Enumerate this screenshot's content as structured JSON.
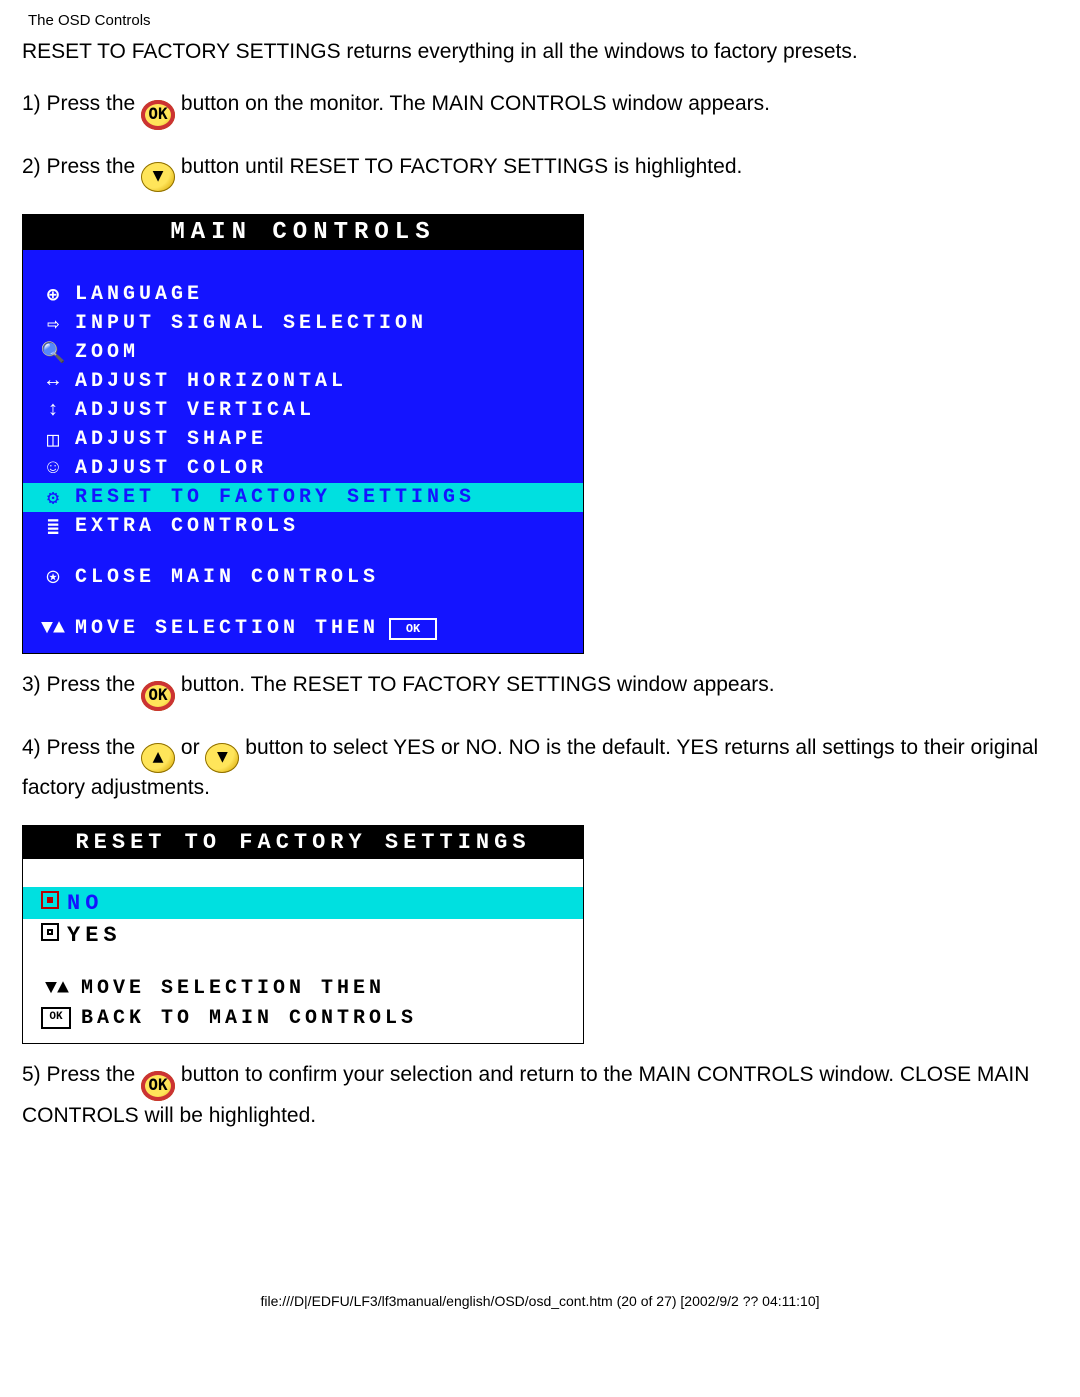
{
  "page_header": "The OSD Controls",
  "intro": "RESET TO FACTORY SETTINGS returns everything in all the windows to factory presets.",
  "steps": {
    "s1a": "1) Press the ",
    "s1b": " button on the monitor. The MAIN CONTROLS window appears.",
    "s2a": "2) Press the ",
    "s2b": " button until RESET TO FACTORY SETTINGS is highlighted.",
    "s3a": "3) Press the ",
    "s3b": " button. The RESET TO FACTORY SETTINGS window appears.",
    "s4a": "4) Press the ",
    "s4b": " or ",
    "s4c": " button to select YES or NO. NO is the default. YES returns all settings to their original factory adjustments.",
    "s5a": "5) Press the ",
    "s5b": " button to confirm your selection and return to the MAIN CONTROLS window. CLOSE MAIN CONTROLS will be highlighted."
  },
  "icon_glyphs": {
    "ok": "OK",
    "down": "▼",
    "up": "▲",
    "updown": "▼▲",
    "okbox": "OK"
  },
  "osd1": {
    "title": "MAIN CONTROLS",
    "items": [
      {
        "icon": "⊕",
        "label": "LANGUAGE"
      },
      {
        "icon": "⇨",
        "label": "INPUT SIGNAL SELECTION"
      },
      {
        "icon": "🔍",
        "label": "ZOOM"
      },
      {
        "icon": "↔",
        "label": "ADJUST HORIZONTAL"
      },
      {
        "icon": "↕",
        "label": "ADJUST VERTICAL"
      },
      {
        "icon": "◫",
        "label": "ADJUST SHAPE"
      },
      {
        "icon": "☺",
        "label": "ADJUST COLOR"
      },
      {
        "icon": "⚙",
        "label": "RESET TO FACTORY SETTINGS"
      },
      {
        "icon": "≣",
        "label": "EXTRA CONTROLS"
      }
    ],
    "close": {
      "icon": "⍟",
      "label": "CLOSE MAIN CONTROLS"
    },
    "hint": {
      "icon": "▼▲",
      "label": "MOVE SELECTION THEN",
      "ok": "OK"
    }
  },
  "osd2": {
    "title": "RESET TO FACTORY SETTINGS",
    "rows": [
      {
        "label": "NO"
      },
      {
        "label": "YES"
      }
    ],
    "footer": {
      "l1": {
        "icon": "▼▲",
        "label": "MOVE SELECTION THEN"
      },
      "l2": {
        "icon": "OK",
        "label": "BACK TO MAIN CONTROLS"
      }
    }
  },
  "footer_path": "file:///D|/EDFU/LF3/lf3manual/english/OSD/osd_cont.htm (20 of 27) [2002/9/2 ?? 04:11:10]"
}
